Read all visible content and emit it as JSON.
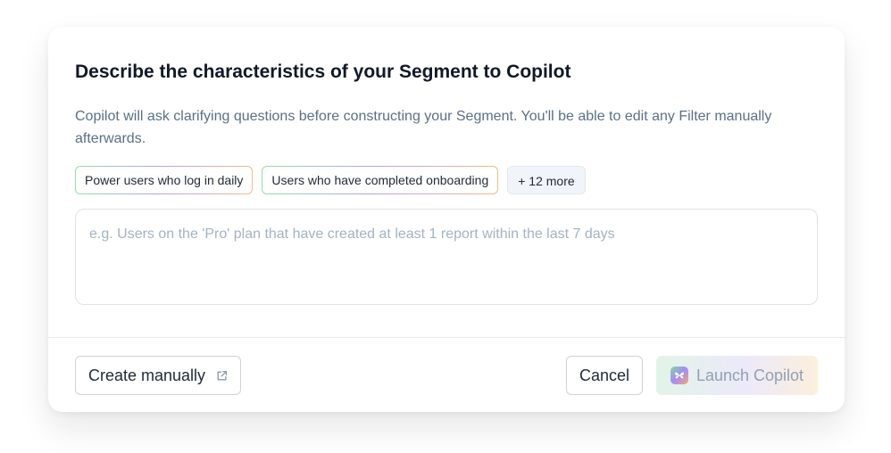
{
  "dialog": {
    "title": "Describe the characteristics of your Segment to Copilot",
    "description": "Copilot will ask clarifying questions before constructing your Segment. You'll be able to edit any Filter manually afterwards.",
    "suggestions": [
      "Power users who log in daily",
      "Users who have completed onboarding"
    ],
    "more_label": "+ 12 more",
    "prompt": {
      "value": "",
      "placeholder": "e.g. Users on the 'Pro' plan that have created at least 1 report within the last 7 days"
    },
    "footer": {
      "create_manually_label": "Create manually",
      "create_manually_icon": "external-link-icon",
      "cancel_label": "Cancel",
      "launch_label": "Launch Copilot",
      "launch_icon": "copilot-logo-icon",
      "launch_disabled": true
    }
  },
  "colors": {
    "title": "#111827",
    "description": "#5b6f86",
    "placeholder": "#a5b2c2",
    "chip_gradient": [
      "#8fe3a6",
      "#b5a2f2",
      "#f7b985"
    ],
    "launch_gradient": [
      "#e2f4e7",
      "#ece9fa",
      "#fcefdd"
    ],
    "launch_text": "#93a0b2"
  }
}
